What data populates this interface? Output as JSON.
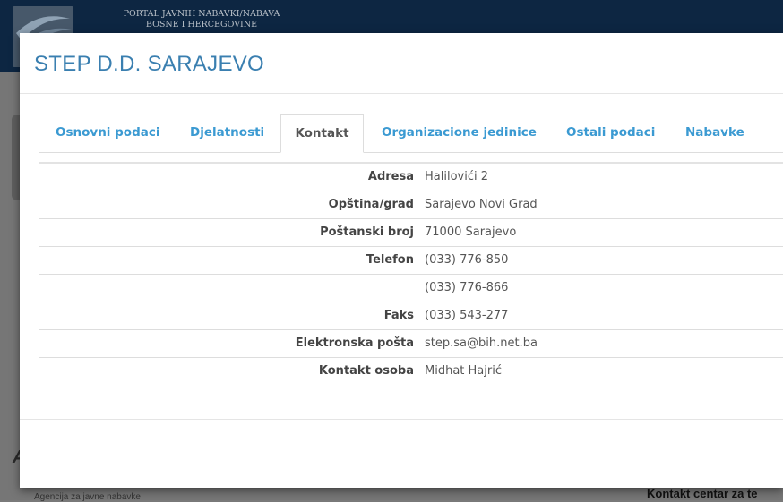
{
  "background": {
    "header_title_line1": "PORTAL JAVNIH NABAVKI/NABAVA",
    "header_title_line2": "BOSNE I HERCEGOVINE",
    "bottom_left_text": "Agencija za javne nabavke",
    "bottom_right_text": "Kontakt centar za te"
  },
  "modal": {
    "title": "STEP D.D. SARAJEVO",
    "tabs": [
      {
        "label": "Osnovni podaci",
        "active": false
      },
      {
        "label": "Djelatnosti",
        "active": false
      },
      {
        "label": "Kontakt",
        "active": true
      },
      {
        "label": "Organizacione jedinice",
        "active": false
      },
      {
        "label": "Ostali podaci",
        "active": false
      },
      {
        "label": "Nabavke",
        "active": false
      }
    ],
    "contact_rows": [
      {
        "label": "Adresa",
        "value": "Halilovići 2"
      },
      {
        "label": "Opština/grad",
        "value": "Sarajevo Novi Grad"
      },
      {
        "label": "Poštanski broj",
        "value": "71000 Sarajevo"
      },
      {
        "label": "Telefon",
        "value": "(033) 776-850"
      },
      {
        "label": "",
        "value": "(033) 776-866"
      },
      {
        "label": "Faks",
        "value": "(033) 543-277"
      },
      {
        "label": "Elektronska pošta",
        "value": "step.sa@bih.net.ba"
      },
      {
        "label": "Kontakt osoba",
        "value": "Midhat Hajrić"
      }
    ]
  },
  "colors": {
    "title": "#3a7fb0",
    "tab_link": "#3b9ad2",
    "header_bg": "#0d2642"
  }
}
